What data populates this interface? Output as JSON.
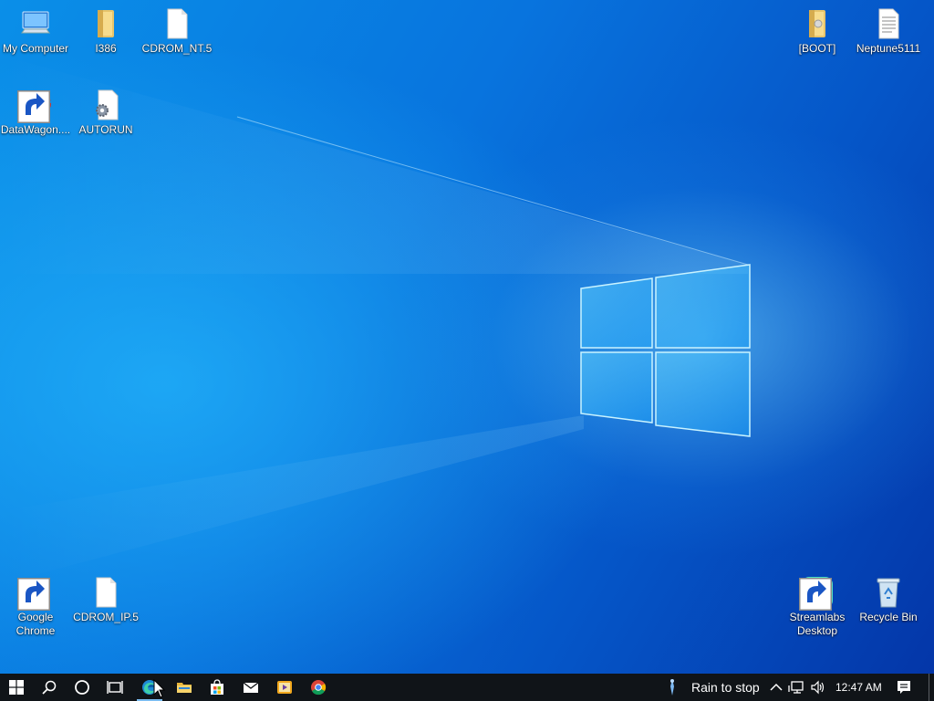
{
  "desktop": {
    "icons": [
      {
        "label": "My Computer",
        "icon": "computer-icon"
      },
      {
        "label": "I386",
        "icon": "folder-icon"
      },
      {
        "label": "CDROM_NT.5",
        "icon": "blank-file-icon"
      },
      {
        "label": "[BOOT]",
        "icon": "folder-icon"
      },
      {
        "label": "Neptune5111",
        "icon": "text-file-icon"
      },
      {
        "label": "DataWagon....",
        "icon": "datawagon-app-icon"
      },
      {
        "label": "AUTORUN",
        "icon": "settings-file-icon"
      },
      {
        "label": "Google Chrome",
        "icon": "chrome-icon"
      },
      {
        "label": "CDROM_IP.5",
        "icon": "blank-file-icon"
      },
      {
        "label": "Streamlabs Desktop",
        "icon": "streamlabs-icon"
      },
      {
        "label": "Recycle Bin",
        "icon": "recycle-bin-icon"
      }
    ]
  },
  "taskbar": {
    "buttons": [
      {
        "name": "start-button",
        "icon": "windows-start-icon"
      },
      {
        "name": "search-button",
        "icon": "search-icon"
      },
      {
        "name": "cortana-button",
        "icon": "cortana-circle-icon"
      },
      {
        "name": "task-view-button",
        "icon": "task-view-icon"
      },
      {
        "name": "edge-button",
        "icon": "edge-icon"
      },
      {
        "name": "file-explorer-button",
        "icon": "folder-icon"
      },
      {
        "name": "store-button",
        "icon": "store-bag-icon"
      },
      {
        "name": "mail-button",
        "icon": "mail-icon"
      },
      {
        "name": "media-player-button",
        "icon": "media-player-icon"
      },
      {
        "name": "chrome-button",
        "icon": "chrome-icon"
      }
    ],
    "weather": "Rain to stop",
    "clock": "12:47 AM"
  },
  "colors": {
    "taskbar": "#101418",
    "accent": "#0a8fe8"
  }
}
